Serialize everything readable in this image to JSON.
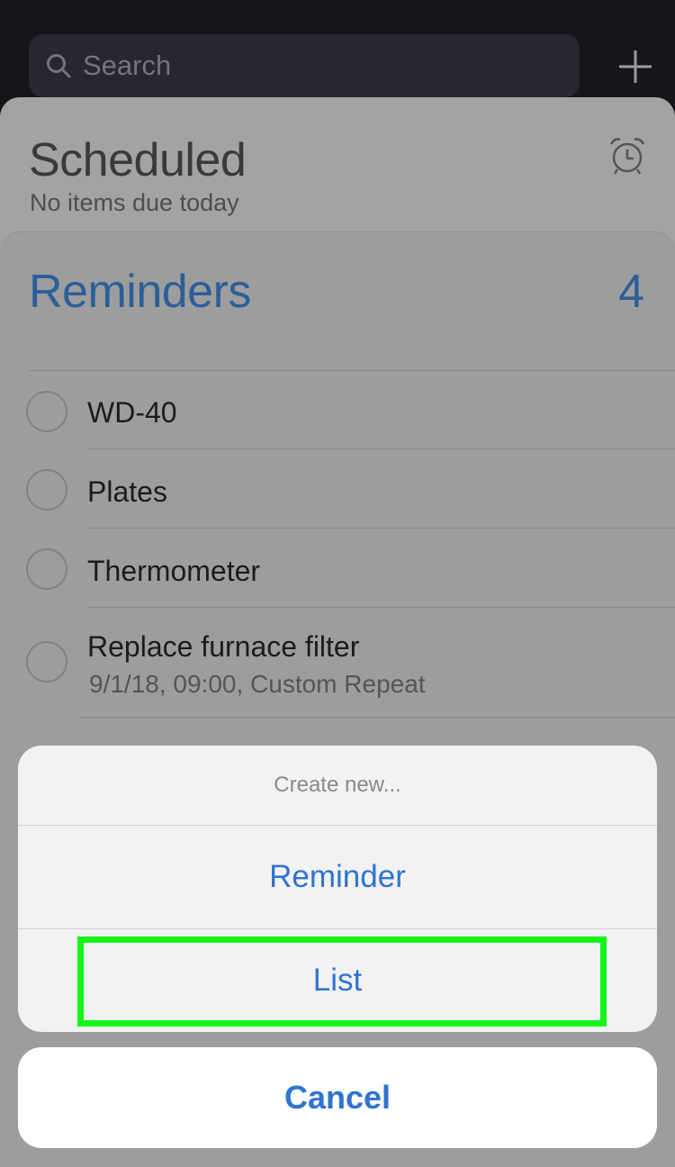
{
  "search": {
    "placeholder": "Search",
    "icon": "search-icon"
  },
  "header": {
    "add_icon": "plus-icon"
  },
  "scheduled": {
    "title": "Scheduled",
    "subtitle": "No items due today",
    "icon": "alarm-clock-icon"
  },
  "reminders": {
    "title": "Reminders",
    "count": "4",
    "items": [
      {
        "title": "WD-40"
      },
      {
        "title": "Plates"
      },
      {
        "title": "Thermometer"
      },
      {
        "title": "Replace furnace filter",
        "detail": "9/1/18, 09:00, Custom Repeat"
      }
    ]
  },
  "action_sheet": {
    "header": "Create new...",
    "options": [
      "Reminder",
      "List"
    ],
    "cancel": "Cancel",
    "highlighted_option": "List"
  },
  "colors": {
    "accent": "#2f74d0",
    "list_title": "#2b5f9a",
    "highlight": "#16f51a"
  }
}
